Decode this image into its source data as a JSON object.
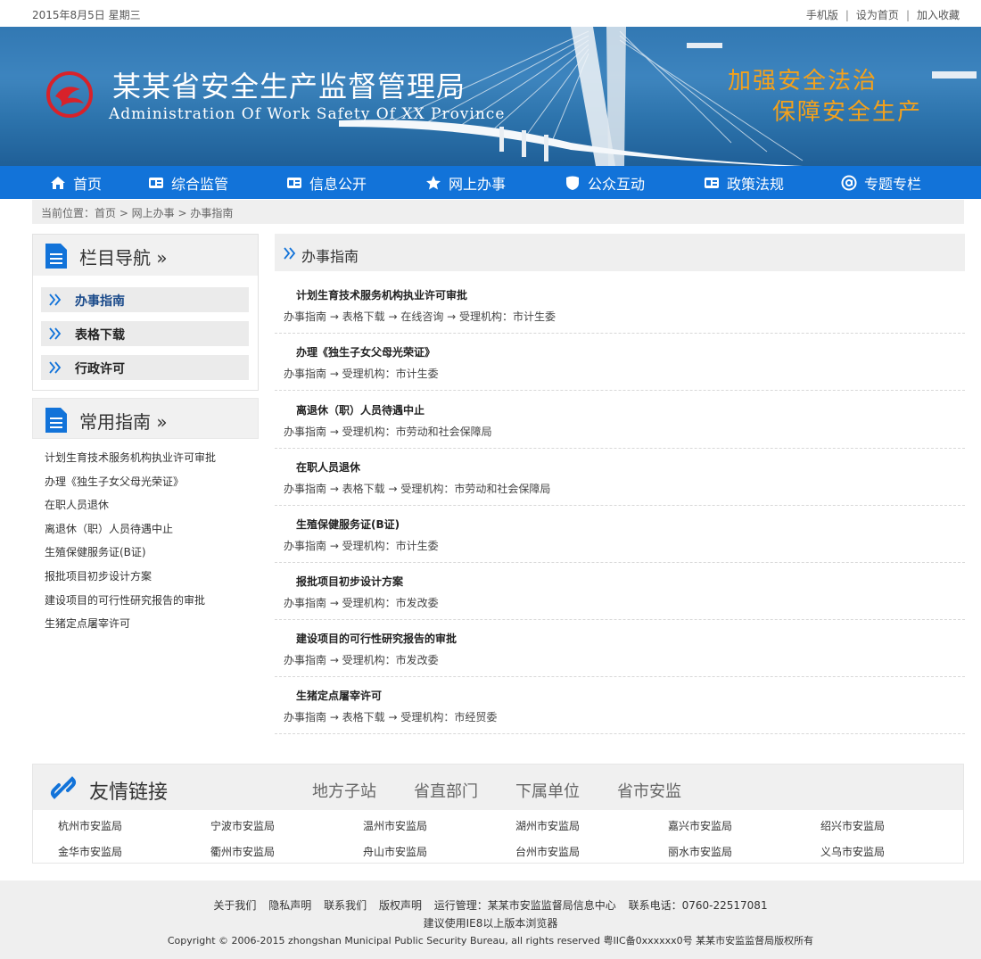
{
  "topbar": {
    "date": "2015年8月5日 星期三",
    "links": [
      "手机版",
      "设为首页",
      "加入收藏"
    ]
  },
  "banner": {
    "title_cn": "某某省安全生产监督管理局",
    "title_en": "Administration Of Work Safety Of XX Province",
    "slogan_1": "加强安全法治",
    "slogan_2": "保障安全生产",
    "slogan_color": "#f4a11b"
  },
  "nav": {
    "color": "#1273d9",
    "items": [
      {
        "label": "首页",
        "icon": "home-icon"
      },
      {
        "label": "综合监管",
        "icon": "card-icon"
      },
      {
        "label": "信息公开",
        "icon": "card-icon"
      },
      {
        "label": "网上办事",
        "icon": "star-icon"
      },
      {
        "label": "公众互动",
        "icon": "shield-icon"
      },
      {
        "label": "政策法规",
        "icon": "card-icon"
      },
      {
        "label": "专题专栏",
        "icon": "at-icon"
      }
    ]
  },
  "breadcrumb": "当前位置：首页 > 网上办事 > 办事指南",
  "sidebar": {
    "nav_title": "栏目导航 »",
    "nav_items": [
      "办事指南",
      "表格下载",
      "行政许可"
    ],
    "common_title": "常用指南 »",
    "common_items": [
      "计划生育技术服务机构执业许可审批",
      "办理《独生子女父母光荣证》",
      "在职人员退休",
      "离退休（职）人员待遇中止",
      "生殖保健服务证(B证)",
      "报批项目初步设计方案",
      "建设项目的可行性研究报告的审批",
      "生猪定点屠宰许可"
    ]
  },
  "main": {
    "title": "办事指南",
    "entries": [
      {
        "title": "计划生育技术服务机构执业许可审批",
        "meta": "办事指南 → 表格下载 → 在线咨询 → 受理机构：市计生委"
      },
      {
        "title": "办理《独生子女父母光荣证》",
        "meta": "办事指南 → 受理机构：市计生委"
      },
      {
        "title": "离退休（职）人员待遇中止",
        "meta": "办事指南 → 受理机构：市劳动和社会保障局"
      },
      {
        "title": "在职人员退休",
        "meta": "办事指南 → 表格下载 → 受理机构：市劳动和社会保障局"
      },
      {
        "title": "生殖保健服务证(B证)",
        "meta": "办事指南 → 受理机构：市计生委"
      },
      {
        "title": "报批项目初步设计方案",
        "meta": "办事指南 → 受理机构：市发改委"
      },
      {
        "title": "建设项目的可行性研究报告的审批",
        "meta": "办事指南 → 受理机构：市发改委"
      },
      {
        "title": "生猪定点屠宰许可",
        "meta": "办事指南 → 表格下载 → 受理机构：市经贸委"
      }
    ]
  },
  "friend_links": {
    "title": "友情链接",
    "tabs": [
      "地方子站",
      "省直部门",
      "下属单位",
      "省市安监"
    ],
    "rows": [
      [
        "杭州市安监局",
        "宁波市安监局",
        "温州市安监局",
        "湖州市安监局",
        "嘉兴市安监局",
        "绍兴市安监局"
      ],
      [
        "金华市安监局",
        "衢州市安监局",
        "舟山市安监局",
        "台州市安监局",
        "丽水市安监局",
        "义乌市安监局"
      ]
    ]
  },
  "footer": {
    "links": [
      "关于我们",
      "隐私声明",
      "联系我们",
      "版权声明"
    ],
    "operator": "运行管理：某某市安监监督局信息中心",
    "phone": "联系电话：0760-22517081",
    "browser_note": "建议使用IE8以上版本浏览器",
    "copyright": "Copyright © 2006-2015 zhongshan Municipal Public Security Bureau, all rights reserved 粤IIC备0xxxxxx0号 某某市安监监督局版权所有"
  }
}
